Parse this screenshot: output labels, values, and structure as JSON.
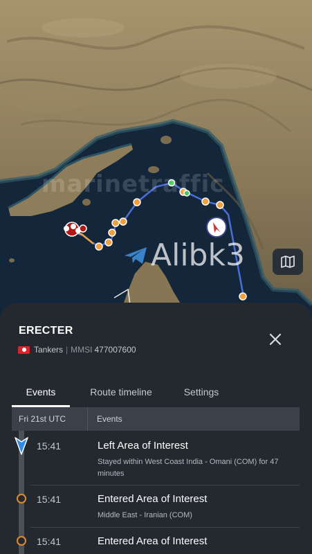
{
  "map": {
    "watermark_faint": "marinetraffic",
    "watermark_channel": "Alibk3"
  },
  "vessel": {
    "name": "ERECTER",
    "type": "Tankers",
    "separator": "|",
    "mmsi_label": "MMSI",
    "mmsi": "477007600"
  },
  "tabs": [
    {
      "label": "Events",
      "active": true
    },
    {
      "label": "Route timeline",
      "active": false
    },
    {
      "label": "Settings",
      "active": false
    }
  ],
  "table": {
    "date_header": "Fri 21st UTC",
    "events_header": "Events"
  },
  "events": [
    {
      "time": "15:41",
      "title": "Left Area of Interest",
      "description": "Stayed within West Coast India - Omani (COM) for 47 minutes"
    },
    {
      "time": "15:41",
      "title": "Entered Area of Interest",
      "description": "Middle East - Iranian (COM)"
    },
    {
      "time": "15:41",
      "title": "Entered Area of Interest",
      "description": ""
    }
  ],
  "colors": {
    "route": "#4a6fd8",
    "stop": "#f0a040",
    "flag": "#d7262b",
    "panel_bg": "#24292f"
  },
  "icons": [
    "map-layers-icon",
    "close-icon",
    "hong-kong-flag-icon",
    "position-marker-icon",
    "telegram-icon"
  ]
}
